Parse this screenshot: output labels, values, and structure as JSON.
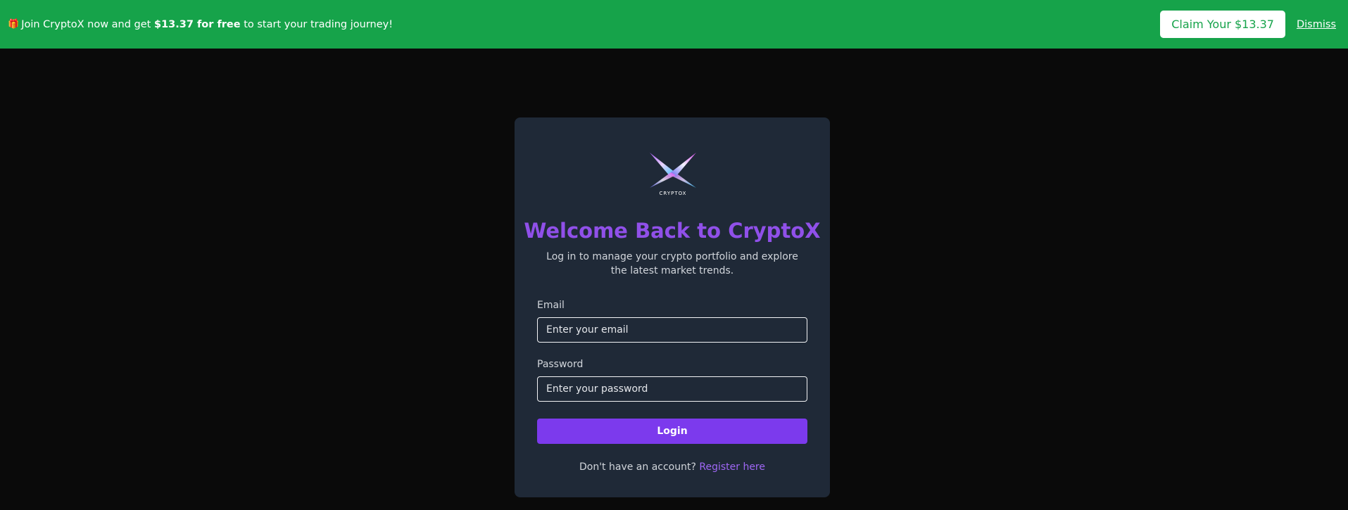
{
  "promo": {
    "gift_icon": "gift-icon",
    "text_before": "Join CryptoX now and get",
    "text_bold": "$13.37 for free",
    "text_after": "to start your trading journey!",
    "claim_label": "Claim Your $13.37",
    "dismiss_label": "Dismiss",
    "bg_color": "#16a34a"
  },
  "login": {
    "logo_text": "CRYPTOX",
    "title": "Welcome Back to CryptoX",
    "subtitle": "Log in to manage your crypto portfolio and explore the latest market trends.",
    "email_label": "Email",
    "email_placeholder": "Enter your email",
    "email_value": "",
    "password_label": "Password",
    "password_placeholder": "Enter your password",
    "password_value": "",
    "login_label": "Login",
    "register_prompt": "Don't have an account?",
    "register_link": "Register here",
    "accent_color": "#7c3aed"
  }
}
